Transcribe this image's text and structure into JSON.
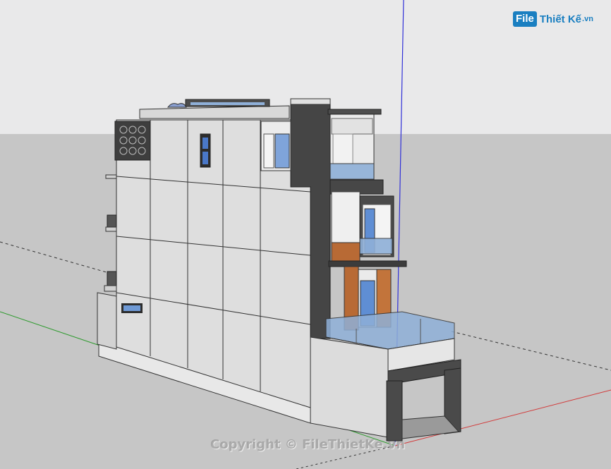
{
  "app": {
    "canvas_label": "3D model viewport"
  },
  "logo": {
    "badge": "File",
    "name": "Thiết Kế",
    "tld": ".vn"
  },
  "watermark": {
    "text": "Copyright © FileThietKe.vn"
  },
  "colors": {
    "sky": "#e9e9ea",
    "ground": "#c6c6c6",
    "wall_light": "#dedede",
    "wall_mid": "#cfcfcf",
    "dark_panel": "#4a4a4a",
    "glass": "#8fb0d8",
    "wood": "#b86a35",
    "axis_green": "#2f9b2f",
    "axis_red": "#d23b3b",
    "axis_blue": "#3030d8"
  }
}
